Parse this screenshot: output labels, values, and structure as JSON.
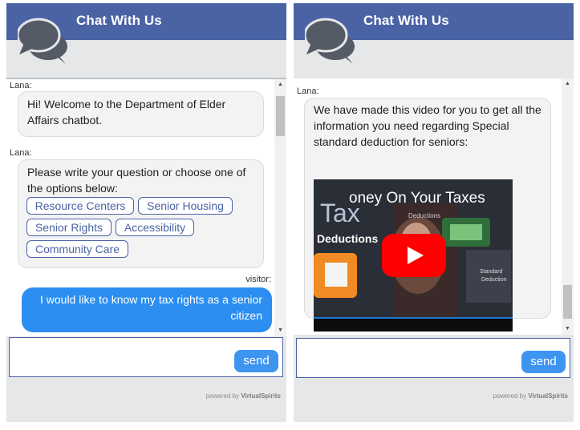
{
  "left_panel": {
    "header_title": "Chat With Us",
    "messages": [
      {
        "sender": "Lana:",
        "text": "Hi! Welcome to the Department of Elder Affairs chatbot."
      },
      {
        "sender": "Lana:",
        "text": "Please write your question or choose one of the options below:",
        "options": [
          "Resource Centers",
          "Senior Housing",
          "Senior Rights",
          "Accessibility",
          "Community Care"
        ]
      },
      {
        "sender": "visitor:",
        "text": "I would like to know my tax rights as a senior citizen"
      }
    ],
    "input": {
      "value": "",
      "placeholder": ""
    },
    "send_label": "send",
    "powered_prefix": "powered by",
    "powered_brand": "VirtualSpirits"
  },
  "right_panel": {
    "header_title": "Chat With Us",
    "messages": [
      {
        "sender": "Lana:",
        "text": "We have made this video for you to get all the information you need regarding Special standard deduction for seniors:"
      }
    ],
    "video": {
      "title_text": "oney On Your Taxes",
      "overlay_word_1": "Tax",
      "overlay_word_2": "Deductions",
      "small_label_1": "Deductions",
      "small_label_2": "Standard",
      "small_label_3": "Deduction"
    },
    "input": {
      "value": "",
      "placeholder": ""
    },
    "send_label": "send",
    "powered_prefix": "powered by",
    "powered_brand": "VirtualSpirits"
  },
  "colors": {
    "header": "#4a63a4",
    "visitor_bubble": "#2b8ef0",
    "send_button": "#3d95f0",
    "option_border": "#4a63a4"
  },
  "icons": [
    "chat-bubbles-icon",
    "play-icon",
    "scroll-up-icon",
    "scroll-down-icon"
  ]
}
